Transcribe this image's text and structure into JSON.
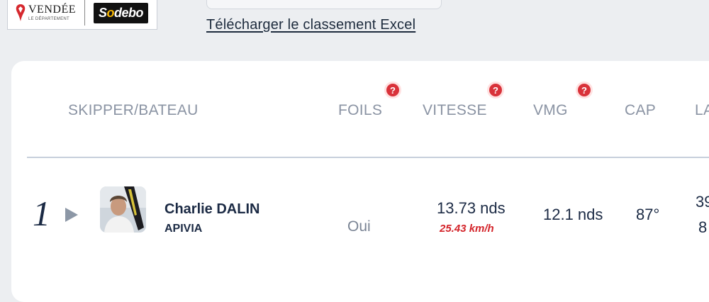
{
  "sponsors": {
    "vendee_name": "VENDÉE",
    "vendee_sub": "LE DÉPARTEMENT",
    "sodebo_prefix": "S",
    "sodebo_o": "o",
    "sodebo_suffix": "debo"
  },
  "toolbar": {
    "excel_link": "Télécharger le classement Excel"
  },
  "table": {
    "headers": {
      "skipper": "SKIPPER/BATEAU",
      "foils": "FOILS",
      "speed": "VITESSE",
      "vmg": "VMG",
      "heading": "CAP",
      "lat_partial": "LA"
    },
    "help_glyph": "?",
    "rows": [
      {
        "rank": "1",
        "skipper": "Charlie DALIN",
        "boat": "APIVIA",
        "foils": "Oui",
        "speed_knots": "13.73 nds",
        "speed_kmh": "25.43 km/h",
        "vmg": "12.1 nds",
        "heading": "87°",
        "lat_partial_1": "39",
        "lat_partial_2": "8"
      }
    ]
  },
  "colors": {
    "background": "#eceef1",
    "card": "#ffffff",
    "text_dark": "#1b2a44",
    "header_text": "#8a93a3",
    "help_red": "#d9323a",
    "kmh_red": "#d4252b"
  }
}
